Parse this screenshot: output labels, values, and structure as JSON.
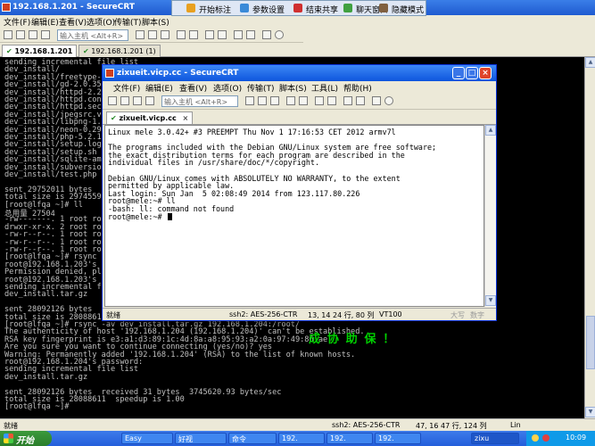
{
  "back_window": {
    "title": "192.168.1.201 - SecureCRT",
    "menu": [
      "文件(F)",
      "编辑(E)",
      "查看(V)",
      "选项(O)",
      "传输(T)",
      "脚本(S)"
    ],
    "host_placeholder": "输入主机",
    "host_hint": "<Alt+R>",
    "tabs": [
      "192.168.1.201",
      "192.168.1.201 (1)"
    ],
    "terminal_lines": [
      "sending incremental file list",
      "dev_install/",
      "dev_install/freetype-",
      "dev_install/gd-2.0.35",
      "dev_install/httpd-2.2",
      "dev_install/httpd.con",
      "dev_install/httpd.sec",
      "dev_install/jpegsrc.v",
      "dev_install/libpng-1.",
      "dev_install/neon-0.29",
      "dev_install/php-5.2.1",
      "dev_install/setup.log",
      "dev_install/setup.sh",
      "dev_install/sqlite-am",
      "dev_install/subversio",
      "dev_install/test.php",
      "",
      "sent 29752011 bytes",
      "total size is 2974559",
      "[root@lfqa ~]# ll",
      "总用量 27504",
      "-rw-------. 1 root ro",
      "drwxr-xr-x. 2 root ro",
      "-rw-r--r--. 1 root ro",
      "-rw-r--r--. 1 root ro",
      "-rw-r--r--. 1 root ro",
      "[root@lfqa ~]# rsync",
      "root@192.168.1.203's",
      "Permission denied, pl",
      "root@192.168.1.203's",
      "sending incremental f",
      "dev_install.tar.gz",
      "",
      "sent 28092126 bytes",
      "total size is 2808861",
      "[root@lfqa ~]# rsync -av dev_install.tar.gz 192.168.1.204:/root/",
      "The authenticity of host '192.168.1.204 (192.168.1.204)' can't be established.",
      "RSA key fingerprint is e3:a1:d3:89:1c:4d:8a:a8:95:93:a2:0a:97:49:86:ae.",
      "Are you sure you want to continue connecting (yes/no)? yes",
      "Warning: Permanently added '192.168.1.204' (RSA) to the list of known hosts.",
      "root@192.168.1.204's password:",
      "sending incremental file list",
      "dev_install.tar.gz",
      "",
      "sent 28092126 bytes  received 31 bytes  3745620.93 bytes/sec",
      "total size is 28088611  speedup is 1.00",
      "[root@lfqa ~]#"
    ],
    "status": {
      "left": "就绪",
      "session": "ssh2: AES-256-CTR",
      "pos": "47,  16 47 行, 124 列",
      "term": "Lin"
    }
  },
  "annotation_bar": {
    "items": [
      "开始标注",
      "参数设置",
      "结束共享",
      "聊天窗口",
      "隐藏模式"
    ]
  },
  "overlay_chars": {
    "left": "要看",
    "right": "成 协 助 保 ！"
  },
  "front_window": {
    "title": "zixueit.vicp.cc - SecureCRT",
    "menu": [
      "文件(F)",
      "编辑(E)",
      "查看(V)",
      "选项(O)",
      "传输(T)",
      "脚本(S)",
      "工具(L)",
      "帮助(H)"
    ],
    "host_placeholder": "输入主机",
    "host_hint": "<Alt+R>",
    "tab": "zixueit.vicp.cc",
    "terminal_lines": [
      "Linux mele 3.0.42+ #3 PREEMPT Thu Nov 1 17:16:53 CET 2012 armv7l",
      "",
      "The programs included with the Debian GNU/Linux system are free software;",
      "the exact distribution terms for each program are described in the",
      "individual files in /usr/share/doc/*/copyright.",
      "",
      "Debian GNU/Linux comes with ABSOLUTELY NO WARRANTY, to the extent",
      "permitted by applicable law.",
      "Last login: Sun Jan  5 02:08:49 2014 from 123.117.80.226",
      "root@mele:~# ll",
      "-bash: ll: command not found",
      "root@mele:~#"
    ],
    "status": {
      "left": "就绪",
      "session": "ssh2: AES-256-CTR",
      "pos": "13,  14 24 行,  80 列",
      "term": "VT100",
      "caps": "大写",
      "num": "数字"
    }
  },
  "taskbar": {
    "start": "开始",
    "tasks": [
      "Easy",
      "好视",
      "命令",
      "192.",
      "192.",
      "192.",
      "zixu"
    ],
    "clock": "10:09"
  },
  "colors": {
    "title_blue": "#0d55dd",
    "close_red": "#e0442a",
    "terminal_bg": "#000000",
    "overlay_orange": "#ff8c00",
    "overlay_green": "#00d000"
  }
}
